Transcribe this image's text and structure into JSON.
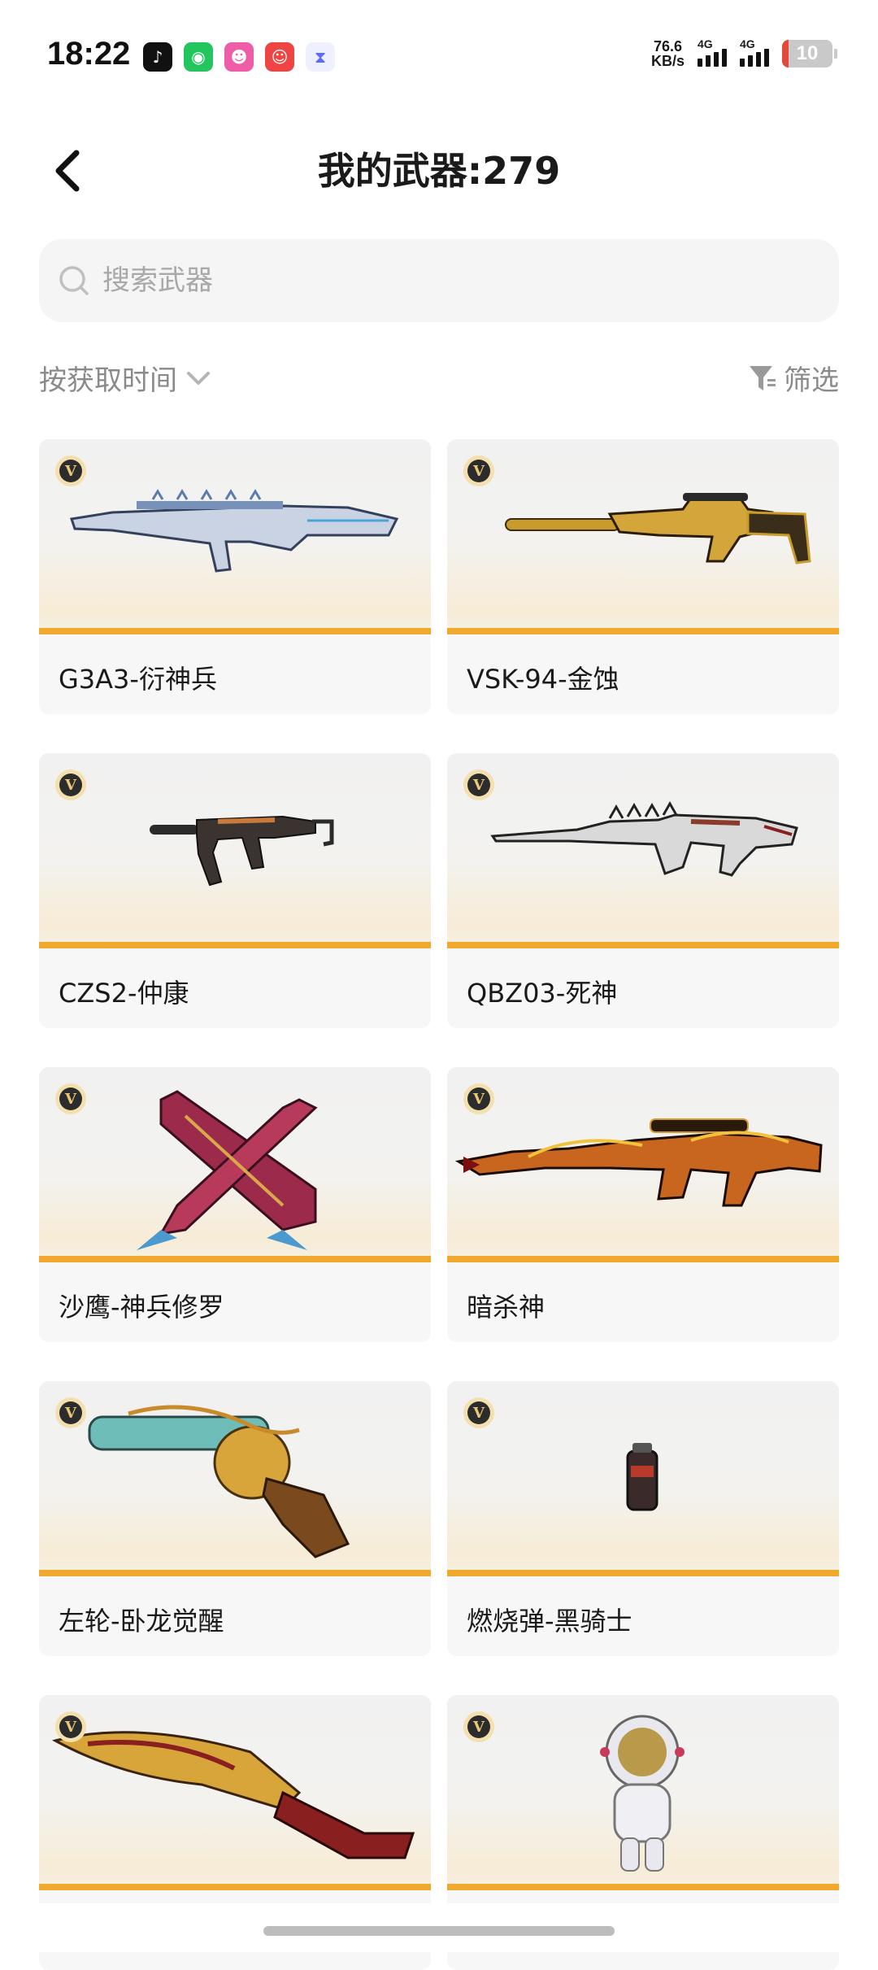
{
  "status_bar": {
    "time": "18:22",
    "net_speed_value": "76.6",
    "net_speed_unit": "KB/s",
    "signal1_label": "4G",
    "signal2_label": "4G",
    "battery": "10"
  },
  "nav": {
    "title": "我的武器:279"
  },
  "search": {
    "placeholder": "搜索武器",
    "value": ""
  },
  "toolbar": {
    "sort_label": "按获取时间",
    "filter_label": "筛选"
  },
  "badge_letter": "V",
  "weapons": [
    {
      "name": "G3A3-衍神兵",
      "icon": "rifle-icon"
    },
    {
      "name": "VSK-94-金蚀",
      "icon": "sniper-rifle-icon"
    },
    {
      "name": "CZS2-仲康",
      "icon": "smg-icon"
    },
    {
      "name": "QBZ03-死神",
      "icon": "assault-rifle-icon"
    },
    {
      "name": "沙鹰-神兵修罗",
      "icon": "pistol-icon"
    },
    {
      "name": "暗杀神",
      "icon": "sniper-rifle-icon"
    },
    {
      "name": "左轮-卧龙觉醒",
      "icon": "revolver-icon"
    },
    {
      "name": "燃烧弹-黑骑士",
      "icon": "grenade-icon"
    },
    {
      "name": "",
      "icon": "knife-icon"
    },
    {
      "name": "",
      "icon": "astronaut-icon"
    }
  ],
  "colors": {
    "accent_bar": "#f0a92c",
    "card_bg": "#f7f7f7",
    "muted_text": "#8a8a8a"
  }
}
